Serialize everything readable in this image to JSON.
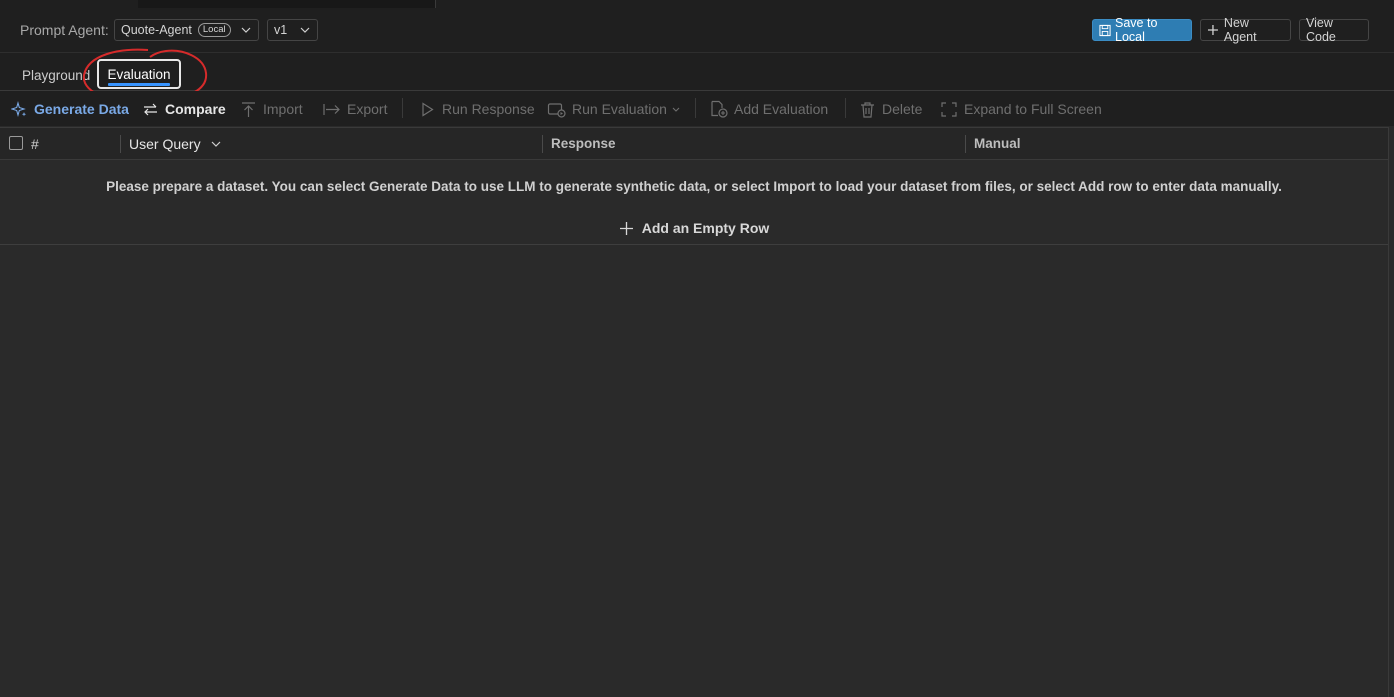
{
  "header": {
    "label": "Prompt Agent:",
    "agent_name": "Quote-Agent",
    "agent_badge": "Local",
    "version": "v1",
    "save_label": "Save to Local",
    "new_agent_label": "New Agent",
    "view_code_label": "View Code"
  },
  "tabs": [
    {
      "label": "Playground"
    },
    {
      "label": "Evaluation"
    }
  ],
  "toolbar": {
    "generate": "Generate Data",
    "compare": "Compare",
    "import": "Import",
    "export": "Export",
    "run_response": "Run Response",
    "run_evaluation": "Run Evaluation",
    "add_evaluation": "Add Evaluation",
    "delete": "Delete",
    "expand": "Expand to Full Screen"
  },
  "table": {
    "columns": [
      "#",
      "User Query",
      "Response",
      "Manual"
    ],
    "empty_message": "Please prepare a dataset. You can select Generate Data to use LLM to generate synthetic data, or select Import to load your dataset from files, or select Add row to enter data manually.",
    "add_row_label": "Add an Empty Row"
  },
  "colors": {
    "accent": "#3794ff",
    "primary_button": "#2e7db3",
    "annotation": "#d62b2b"
  }
}
